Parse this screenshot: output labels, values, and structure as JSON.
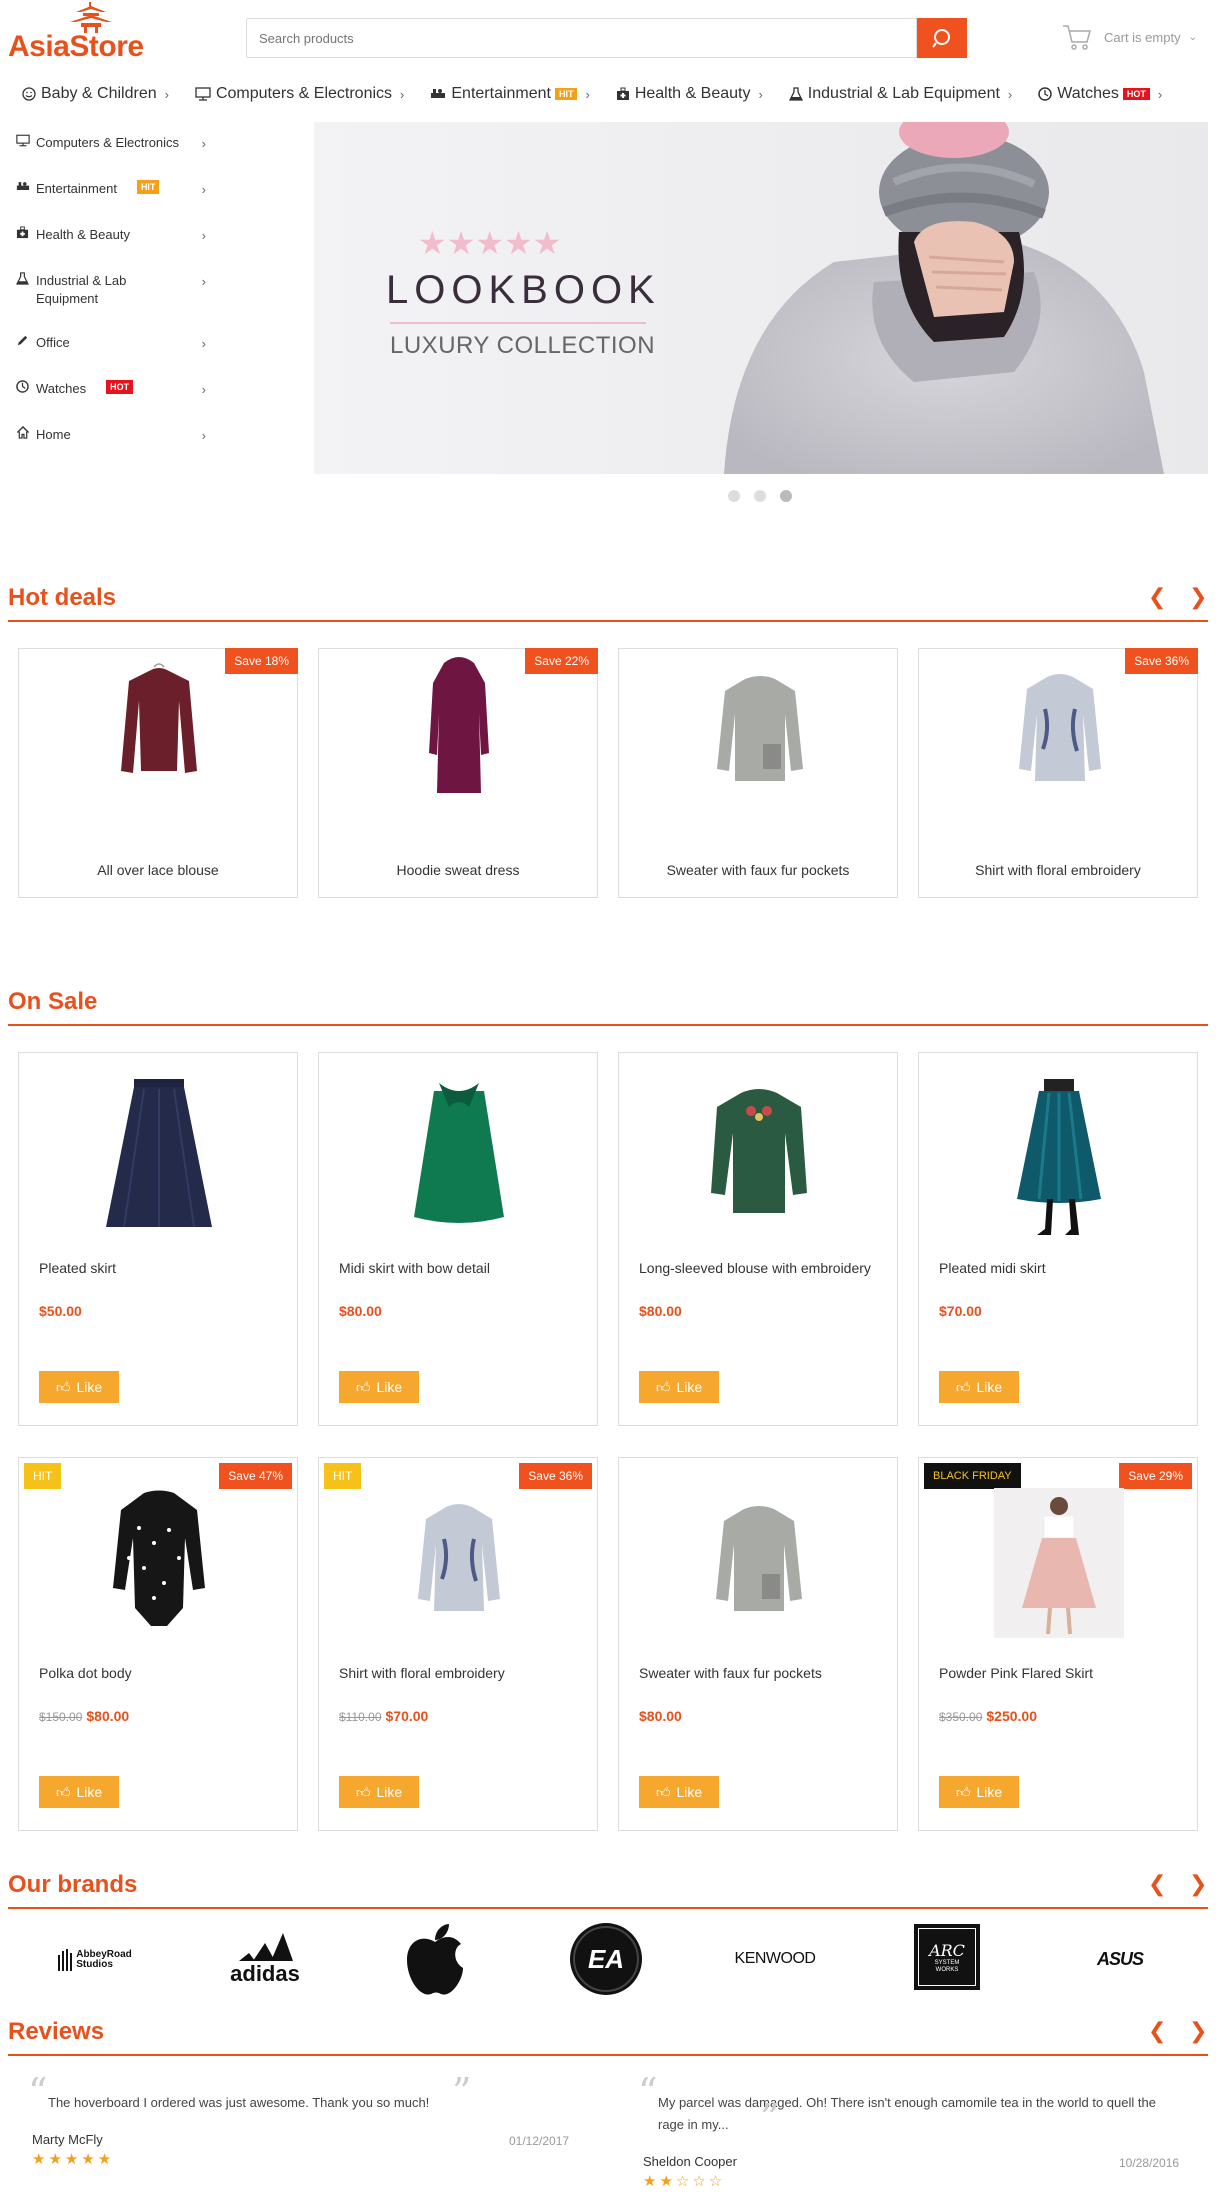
{
  "header": {
    "logo_word_1": "Asia",
    "logo_word_2": "Store",
    "search_placeholder": "Search products",
    "cart_text": "Cart is empty"
  },
  "topnav": [
    {
      "label": "Baby & Children",
      "icon": "smile-icon"
    },
    {
      "label": "Computers & Electronics",
      "icon": "monitor-icon"
    },
    {
      "label": "Entertainment",
      "icon": "couch-icon",
      "badge": "HIT"
    },
    {
      "label": "Health & Beauty",
      "icon": "medkit-icon"
    },
    {
      "label": "Industrial & Lab Equipment",
      "icon": "flask-icon"
    },
    {
      "label": "Watches",
      "icon": "clock-icon",
      "badge": "HOT"
    }
  ],
  "sidebar": [
    {
      "label": "Computers & Electronics",
      "icon": "monitor-icon"
    },
    {
      "label": "Entertainment",
      "icon": "couch-icon",
      "badge": "HIT"
    },
    {
      "label": "Health & Beauty",
      "icon": "medkit-icon"
    },
    {
      "label": "Industrial & Lab\nEquipment",
      "icon": "flask-icon"
    },
    {
      "label": "Office",
      "icon": "pencil-icon"
    },
    {
      "label": "Watches",
      "icon": "clock-icon",
      "badge": "HOT"
    },
    {
      "label": "Home",
      "icon": "home-icon"
    }
  ],
  "banner": {
    "title": "LOOKBOOK",
    "subtitle": "LUXURY COLLECTION",
    "stars": "★★★★★",
    "slides": 3,
    "active_slide": 3
  },
  "hot_deals": {
    "title": "Hot deals",
    "items": [
      {
        "name": "All over lace blouse",
        "save": "Save 18%"
      },
      {
        "name": "Hoodie sweat dress",
        "save": "Save 22%"
      },
      {
        "name": "Sweater with faux fur pockets",
        "save": ""
      },
      {
        "name": "Shirt with floral embroidery",
        "save": "Save 36%"
      }
    ]
  },
  "on_sale": {
    "title": "On Sale",
    "like_label": "Like",
    "items": [
      {
        "name": "Pleated skirt",
        "price": "$50.00",
        "old": ""
      },
      {
        "name": "Midi skirt with bow detail",
        "price": "$80.00",
        "old": ""
      },
      {
        "name": "Long-sleeved blouse with embroidery",
        "price": "$80.00",
        "old": ""
      },
      {
        "name": "Pleated midi skirt",
        "price": "$70.00",
        "old": ""
      },
      {
        "name": "Polka dot body",
        "price": "$80.00",
        "old": "$150.00",
        "tag": "HIT",
        "save": "Save 47%"
      },
      {
        "name": "Shirt with floral embroidery",
        "price": "$70.00",
        "old": "$110.00",
        "tag": "HIT",
        "save": "Save 36%"
      },
      {
        "name": "Sweater with faux fur pockets",
        "price": "$80.00",
        "old": ""
      },
      {
        "name": "Powder Pink Flared Skirt",
        "price": "$250.00",
        "old": "$350.00",
        "tag": "BLACK FRIDAY",
        "save": "Save 29%"
      }
    ]
  },
  "brands": {
    "title": "Our brands",
    "items": [
      {
        "name": "AbbeyRoad Studios",
        "line1": "AbbeyRoad",
        "line2": "Studios"
      },
      {
        "name": "adidas"
      },
      {
        "name": "Apple"
      },
      {
        "name": "EA"
      },
      {
        "name": "KENWOOD"
      },
      {
        "name": "SYSTEM WORKS",
        "line1": "ARC",
        "line2": "SYSTEM WORKS"
      },
      {
        "name": "ASUS"
      }
    ]
  },
  "reviews": {
    "title": "Reviews",
    "items": [
      {
        "text": "The hoverboard I ordered was just awesome. Thank you so much!",
        "author": "Marty McFly",
        "date": "01/12/2017",
        "rating": 5
      },
      {
        "text": "My parcel was damaged. Oh! There isn't enough camomile tea in the world to quell the rage in my...",
        "author": "Sheldon Cooper",
        "date": "10/28/2016",
        "rating": 2
      }
    ]
  },
  "colors": {
    "accent": "#e8501c",
    "like": "#f6a72e",
    "hit": "#f6c21a",
    "hot": "#e8121c"
  }
}
